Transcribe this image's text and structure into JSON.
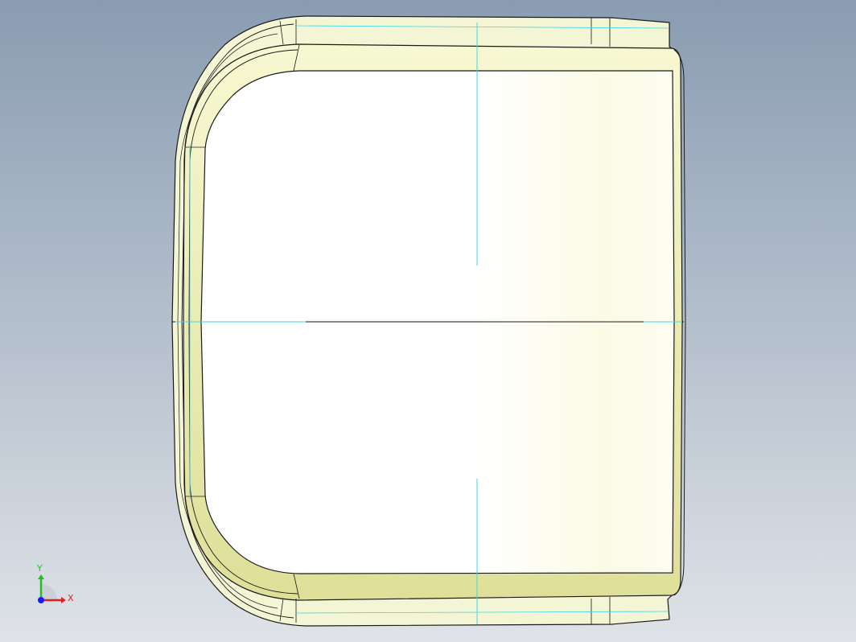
{
  "viewport": {
    "background_top": "#8a9cb2",
    "background_bottom": "#dfe3e8"
  },
  "model": {
    "face_color": "#ffffff",
    "edge_color": "#1a1a1a",
    "rim_color": "#f2f3c0",
    "rim_shadow": "#d6d78c",
    "sketch_line_color": "#3fd6e6"
  },
  "triad": {
    "x_label": "X",
    "y_label": "Y",
    "x_color": "#e02020",
    "y_color": "#20c020",
    "z_color": "#1a1aff"
  }
}
